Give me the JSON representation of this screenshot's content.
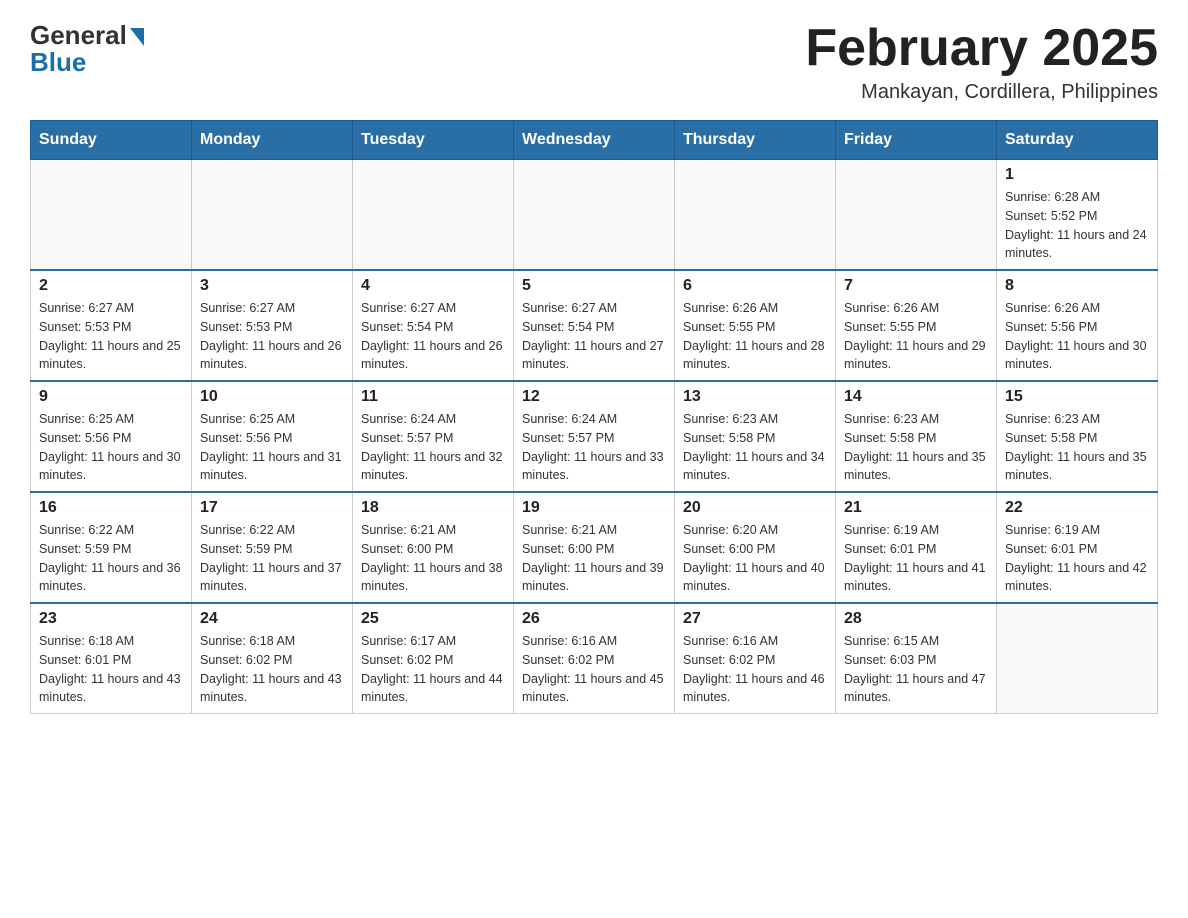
{
  "logo": {
    "general": "General",
    "blue": "Blue"
  },
  "header": {
    "month_year": "February 2025",
    "location": "Mankayan, Cordillera, Philippines"
  },
  "days_of_week": [
    "Sunday",
    "Monday",
    "Tuesday",
    "Wednesday",
    "Thursday",
    "Friday",
    "Saturday"
  ],
  "weeks": [
    [
      {
        "day": "",
        "info": ""
      },
      {
        "day": "",
        "info": ""
      },
      {
        "day": "",
        "info": ""
      },
      {
        "day": "",
        "info": ""
      },
      {
        "day": "",
        "info": ""
      },
      {
        "day": "",
        "info": ""
      },
      {
        "day": "1",
        "info": "Sunrise: 6:28 AM\nSunset: 5:52 PM\nDaylight: 11 hours and 24 minutes."
      }
    ],
    [
      {
        "day": "2",
        "info": "Sunrise: 6:27 AM\nSunset: 5:53 PM\nDaylight: 11 hours and 25 minutes."
      },
      {
        "day": "3",
        "info": "Sunrise: 6:27 AM\nSunset: 5:53 PM\nDaylight: 11 hours and 26 minutes."
      },
      {
        "day": "4",
        "info": "Sunrise: 6:27 AM\nSunset: 5:54 PM\nDaylight: 11 hours and 26 minutes."
      },
      {
        "day": "5",
        "info": "Sunrise: 6:27 AM\nSunset: 5:54 PM\nDaylight: 11 hours and 27 minutes."
      },
      {
        "day": "6",
        "info": "Sunrise: 6:26 AM\nSunset: 5:55 PM\nDaylight: 11 hours and 28 minutes."
      },
      {
        "day": "7",
        "info": "Sunrise: 6:26 AM\nSunset: 5:55 PM\nDaylight: 11 hours and 29 minutes."
      },
      {
        "day": "8",
        "info": "Sunrise: 6:26 AM\nSunset: 5:56 PM\nDaylight: 11 hours and 30 minutes."
      }
    ],
    [
      {
        "day": "9",
        "info": "Sunrise: 6:25 AM\nSunset: 5:56 PM\nDaylight: 11 hours and 30 minutes."
      },
      {
        "day": "10",
        "info": "Sunrise: 6:25 AM\nSunset: 5:56 PM\nDaylight: 11 hours and 31 minutes."
      },
      {
        "day": "11",
        "info": "Sunrise: 6:24 AM\nSunset: 5:57 PM\nDaylight: 11 hours and 32 minutes."
      },
      {
        "day": "12",
        "info": "Sunrise: 6:24 AM\nSunset: 5:57 PM\nDaylight: 11 hours and 33 minutes."
      },
      {
        "day": "13",
        "info": "Sunrise: 6:23 AM\nSunset: 5:58 PM\nDaylight: 11 hours and 34 minutes."
      },
      {
        "day": "14",
        "info": "Sunrise: 6:23 AM\nSunset: 5:58 PM\nDaylight: 11 hours and 35 minutes."
      },
      {
        "day": "15",
        "info": "Sunrise: 6:23 AM\nSunset: 5:58 PM\nDaylight: 11 hours and 35 minutes."
      }
    ],
    [
      {
        "day": "16",
        "info": "Sunrise: 6:22 AM\nSunset: 5:59 PM\nDaylight: 11 hours and 36 minutes."
      },
      {
        "day": "17",
        "info": "Sunrise: 6:22 AM\nSunset: 5:59 PM\nDaylight: 11 hours and 37 minutes."
      },
      {
        "day": "18",
        "info": "Sunrise: 6:21 AM\nSunset: 6:00 PM\nDaylight: 11 hours and 38 minutes."
      },
      {
        "day": "19",
        "info": "Sunrise: 6:21 AM\nSunset: 6:00 PM\nDaylight: 11 hours and 39 minutes."
      },
      {
        "day": "20",
        "info": "Sunrise: 6:20 AM\nSunset: 6:00 PM\nDaylight: 11 hours and 40 minutes."
      },
      {
        "day": "21",
        "info": "Sunrise: 6:19 AM\nSunset: 6:01 PM\nDaylight: 11 hours and 41 minutes."
      },
      {
        "day": "22",
        "info": "Sunrise: 6:19 AM\nSunset: 6:01 PM\nDaylight: 11 hours and 42 minutes."
      }
    ],
    [
      {
        "day": "23",
        "info": "Sunrise: 6:18 AM\nSunset: 6:01 PM\nDaylight: 11 hours and 43 minutes."
      },
      {
        "day": "24",
        "info": "Sunrise: 6:18 AM\nSunset: 6:02 PM\nDaylight: 11 hours and 43 minutes."
      },
      {
        "day": "25",
        "info": "Sunrise: 6:17 AM\nSunset: 6:02 PM\nDaylight: 11 hours and 44 minutes."
      },
      {
        "day": "26",
        "info": "Sunrise: 6:16 AM\nSunset: 6:02 PM\nDaylight: 11 hours and 45 minutes."
      },
      {
        "day": "27",
        "info": "Sunrise: 6:16 AM\nSunset: 6:02 PM\nDaylight: 11 hours and 46 minutes."
      },
      {
        "day": "28",
        "info": "Sunrise: 6:15 AM\nSunset: 6:03 PM\nDaylight: 11 hours and 47 minutes."
      },
      {
        "day": "",
        "info": ""
      }
    ]
  ]
}
